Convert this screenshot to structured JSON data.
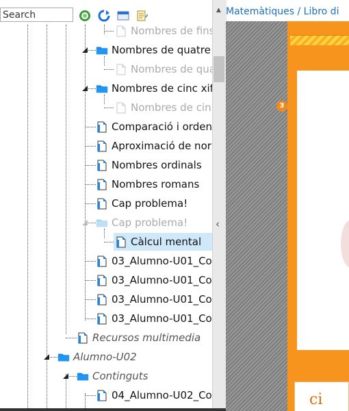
{
  "search": {
    "placeholder": "Search",
    "value": ""
  },
  "toolbar": {
    "icons": [
      "refresh-circle-icon",
      "sync-icon",
      "window-icon",
      "notes-icon"
    ]
  },
  "tree": [
    {
      "label": "Nombres de fins",
      "icon": "doc",
      "dim": true
    },
    {
      "label": "Nombres de quatre",
      "icon": "folder"
    },
    {
      "label": "Nombres de qua",
      "icon": "doc",
      "dim": true
    },
    {
      "label": "Nombres de cinc xif",
      "icon": "folder"
    },
    {
      "label": "Nombres de cin",
      "icon": "doc",
      "dim": true
    },
    {
      "label": "Comparació i orden",
      "icon": "doc"
    },
    {
      "label": "Aproximació de nor",
      "icon": "doc"
    },
    {
      "label": "Nombres ordinals",
      "icon": "doc"
    },
    {
      "label": "Nombres romans",
      "icon": "doc"
    },
    {
      "label": "Cap problema!",
      "icon": "doc"
    },
    {
      "label": "Cap problema!",
      "icon": "folder",
      "dim": true
    },
    {
      "label": "Càlcul mental",
      "icon": "doc",
      "selected": true
    },
    {
      "label": "03_Alumno-U01_Co",
      "icon": "doc"
    },
    {
      "label": "03_Alumno-U01_Co",
      "icon": "doc"
    },
    {
      "label": "03_Alumno-U01_Co",
      "icon": "doc"
    },
    {
      "label": "03_Alumno-U01_Co",
      "icon": "doc"
    },
    {
      "label": "Recursos multimedia",
      "icon": "doc",
      "italic": true
    },
    {
      "label": "Alumno-U02",
      "icon": "folder",
      "italic": true
    },
    {
      "label": "Continguts",
      "icon": "folder",
      "italic": true
    },
    {
      "label": "04_Alumno-U02_Co",
      "icon": "doc"
    }
  ],
  "breadcrumb": "Matemàtiques / Libro di",
  "viewer": {
    "badge_number": "3",
    "bottom_glyph": "ci"
  },
  "colors": {
    "accent_orange": "#f7941d",
    "folder_blue": "#1e88e5",
    "link_blue": "#1a6fbf",
    "selection": "#cfe8fa"
  }
}
